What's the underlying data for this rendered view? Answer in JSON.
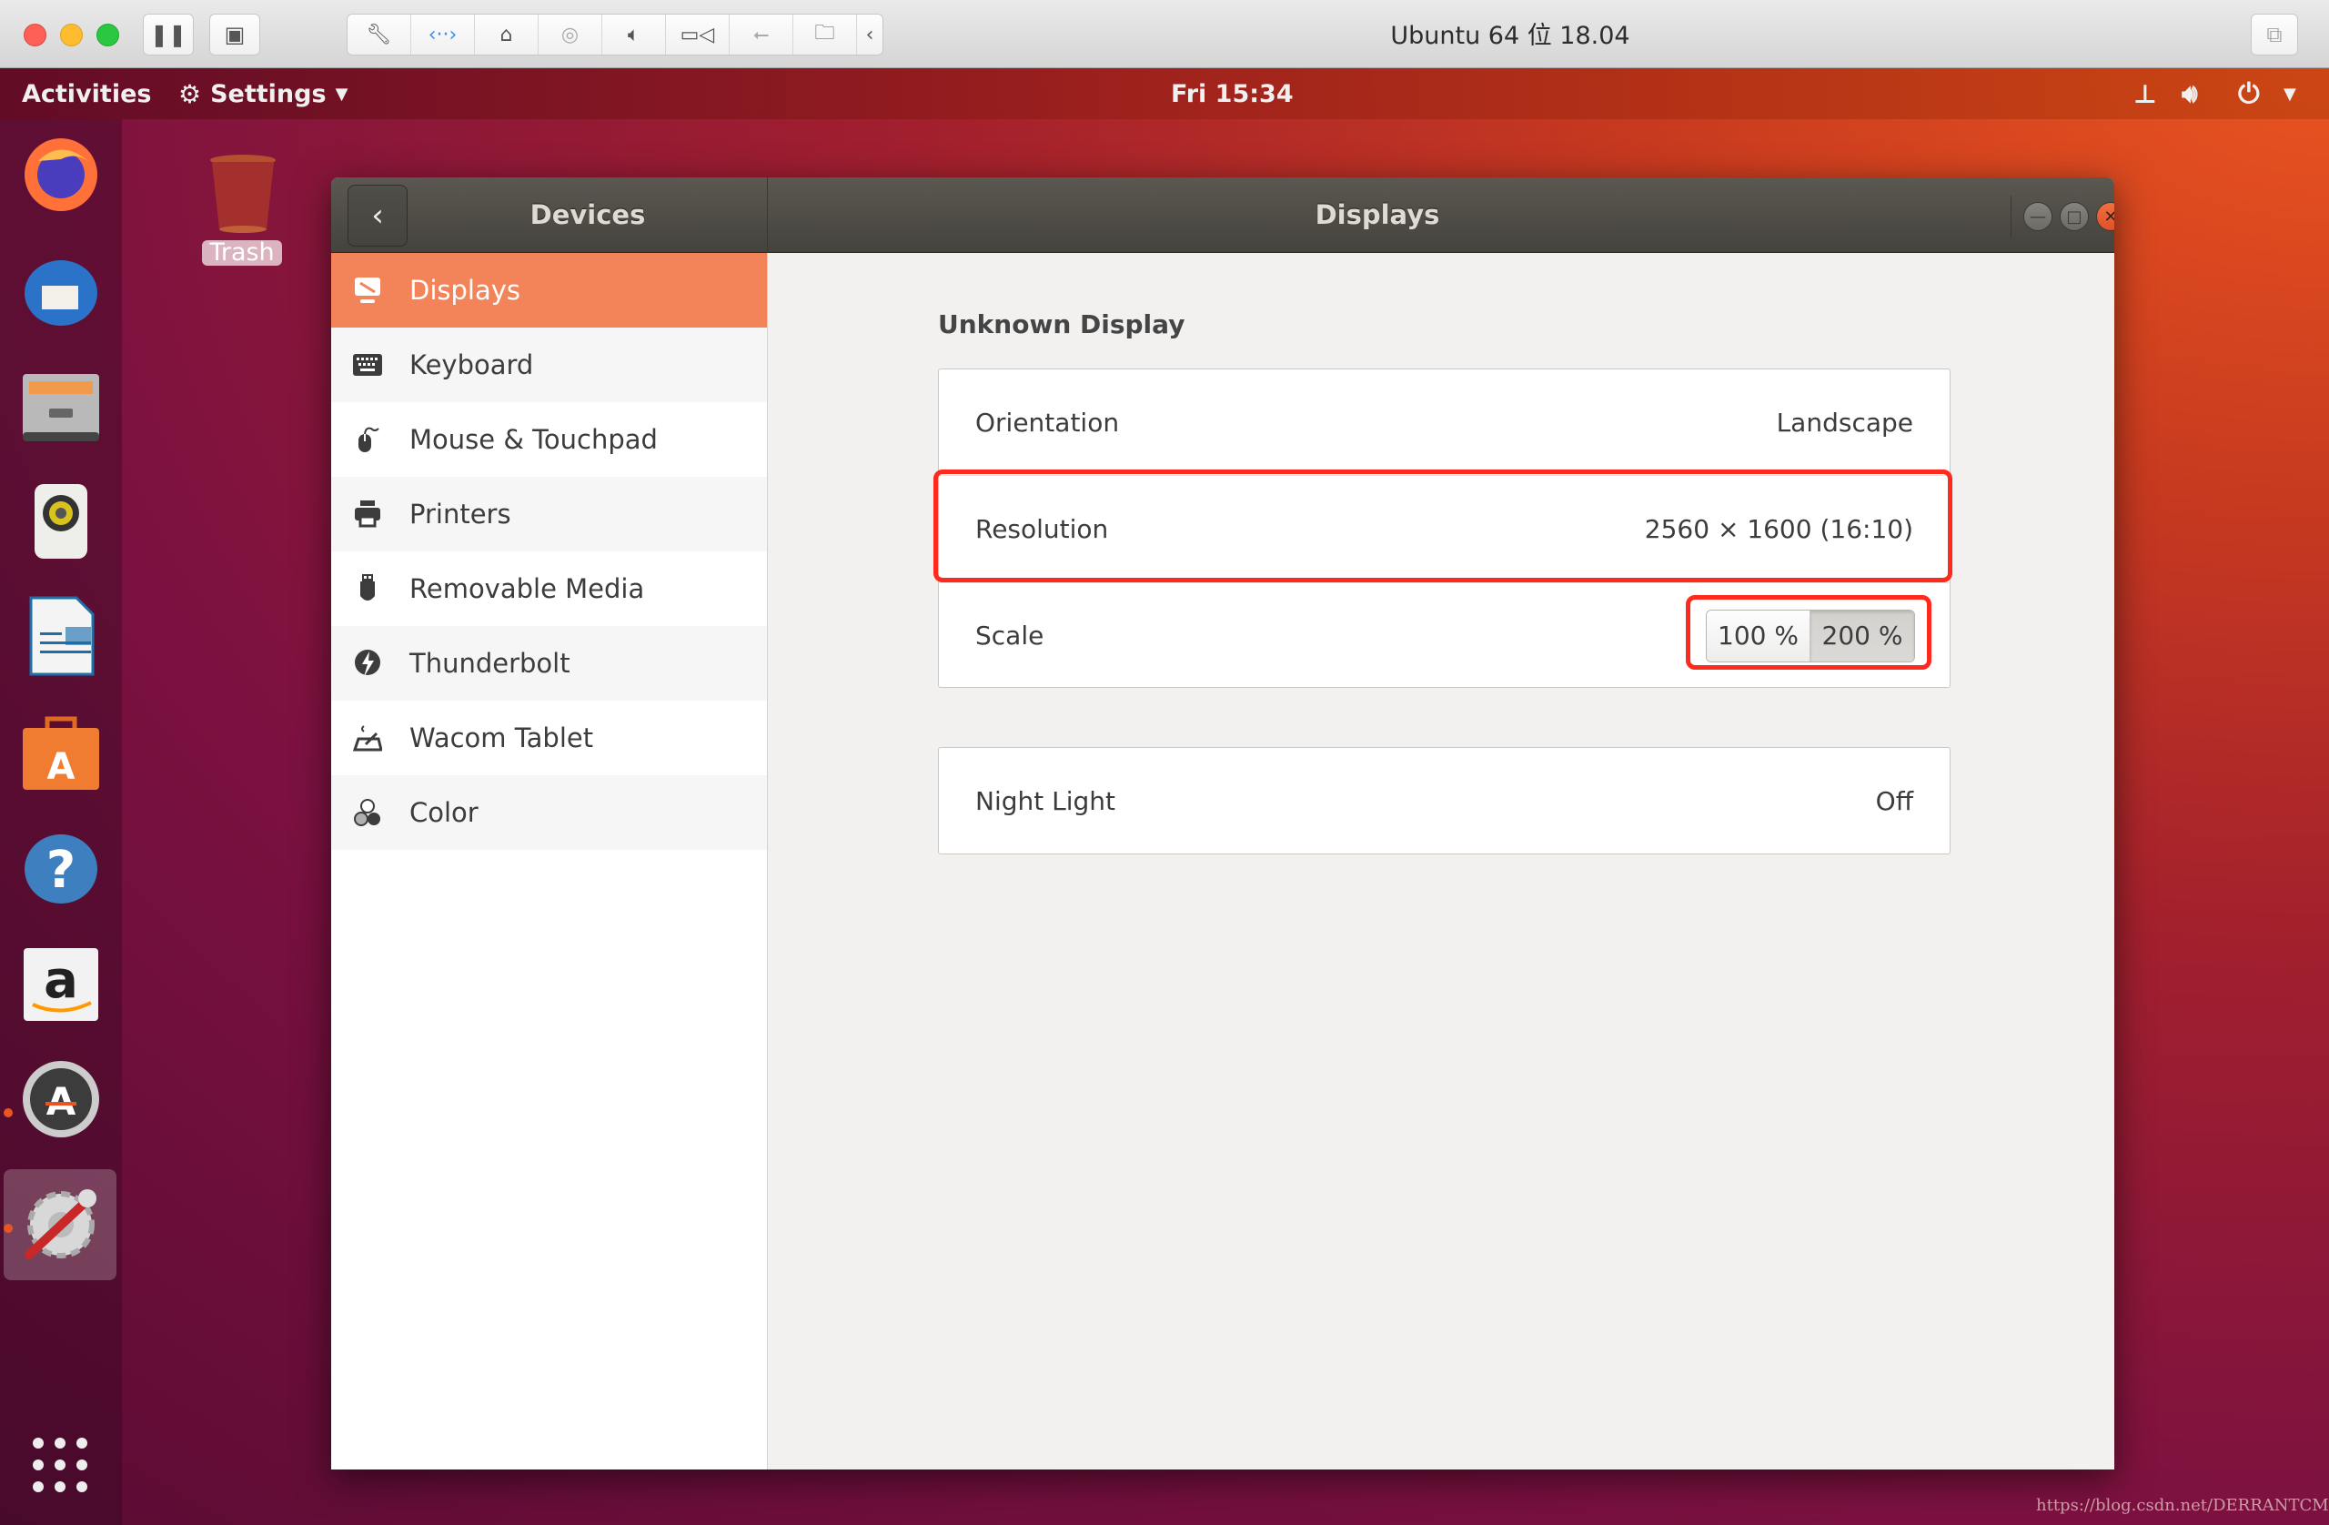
{
  "vm": {
    "title": "Ubuntu 64 位 18.04",
    "toolbar_icons": [
      "pause-icon",
      "snapshot-icon",
      "wrench-icon",
      "network-icon",
      "disk-icon",
      "cd-icon",
      "sound-icon",
      "camera-icon",
      "usb-icon",
      "shared-folder-icon",
      "collapse-icon"
    ]
  },
  "topbar": {
    "activities": "Activities",
    "app_menu": "Settings",
    "clock": "Fri 15:34"
  },
  "dock": {
    "apps": [
      "Firefox",
      "Thunderbird",
      "Files",
      "Rhythmbox",
      "LibreOffice Impress",
      "Ubuntu Software",
      "Help",
      "Amazon",
      "Software Updater",
      "Settings"
    ],
    "active": "Settings"
  },
  "desktop": {
    "trash_label": "Trash"
  },
  "window": {
    "sidebar_title": "Devices",
    "title": "Displays",
    "sidebar": [
      {
        "label": "Displays",
        "icon": "display-icon",
        "active": true
      },
      {
        "label": "Keyboard",
        "icon": "keyboard-icon"
      },
      {
        "label": "Mouse & Touchpad",
        "icon": "mouse-icon"
      },
      {
        "label": "Printers",
        "icon": "printer-icon"
      },
      {
        "label": "Removable Media",
        "icon": "usb-drive-icon"
      },
      {
        "label": "Thunderbolt",
        "icon": "thunderbolt-icon"
      },
      {
        "label": "Wacom Tablet",
        "icon": "tablet-icon"
      },
      {
        "label": "Color",
        "icon": "color-icon"
      }
    ],
    "display": {
      "name": "Unknown Display",
      "orientation_label": "Orientation",
      "orientation_value": "Landscape",
      "resolution_label": "Resolution",
      "resolution_value": "2560 × 1600 (16:10)",
      "scale_label": "Scale",
      "scale_options": [
        "100 %",
        "200 %"
      ],
      "scale_selected": "200 %"
    },
    "night_light": {
      "label": "Night Light",
      "value": "Off"
    }
  },
  "colors": {
    "accent": "#f3845a",
    "annotation": "#ff2a1e"
  },
  "watermark": "https://blog.csdn.net/DERRANTCM"
}
